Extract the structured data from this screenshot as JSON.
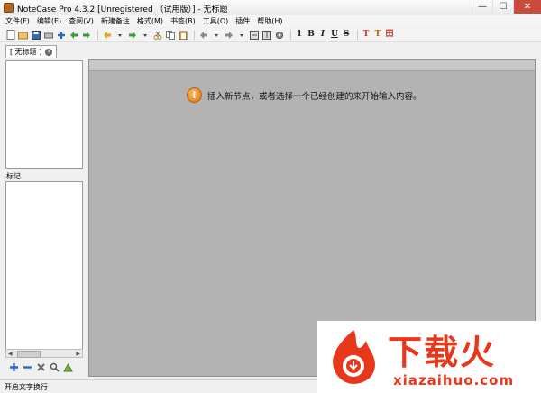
{
  "window": {
    "title": "NoteCase Pro 4.3.2 [Unregistered （试用版）] - 无标题",
    "minimize": "—",
    "maximize": "☐",
    "close": "✕"
  },
  "menu": [
    "文件(F)",
    "编辑(E)",
    "查阅(V)",
    "新建备注",
    "格式(M)",
    "书签(B)",
    "工具(O)",
    "插件",
    "帮助(H)"
  ],
  "toolbar": {
    "icons": [
      "new-file-icon",
      "open-folder-icon",
      "save-icon",
      "print-icon",
      "add-node-icon",
      "back-icon",
      "forward-icon",
      "undo-icon",
      "redo-icon",
      "cut-icon",
      "copy-icon",
      "paste-icon",
      "move-left-icon",
      "move-right-icon",
      "export-icon",
      "import-icon",
      "settings-icon"
    ],
    "format_buttons": [
      "1",
      "B",
      "I",
      "U",
      "S",
      "T",
      "T",
      "田"
    ]
  },
  "tab": {
    "label": "[ 无标题 ]",
    "close": "×"
  },
  "left": {
    "tags_label": "标记"
  },
  "editor": {
    "message": "插入新节点，或者选择一个已经创建的来开始输入内容。",
    "info_glyph": "!"
  },
  "status": {
    "text": "开启文字换行"
  },
  "watermark": {
    "brand": "下载火",
    "domain": "xiazaihuo.com"
  },
  "colors": {
    "editor_bg": "#b3b3b3",
    "info_icon": "#e07410",
    "watermark": "#e8381c"
  }
}
